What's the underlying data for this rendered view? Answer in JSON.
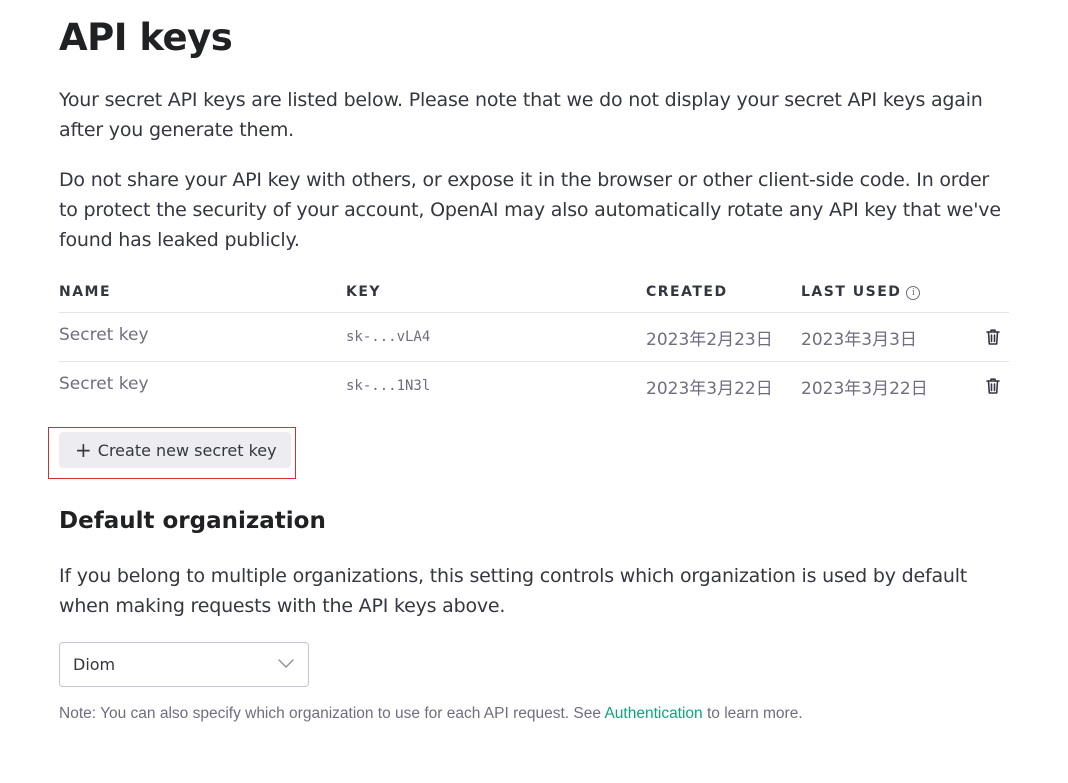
{
  "page": {
    "title": "API keys",
    "intro_1": "Your secret API keys are listed below. Please note that we do not display your secret API keys again after you generate them.",
    "intro_2": "Do not share your API key with others, or expose it in the browser or other client-side code. In order to protect the security of your account, OpenAI may also automatically rotate any API key that we've found has leaked publicly."
  },
  "keys_table": {
    "headers": {
      "name": "NAME",
      "key": "KEY",
      "created": "CREATED",
      "last_used": "LAST USED",
      "last_used_info_icon": "i"
    },
    "rows": [
      {
        "name": "Secret key",
        "key": "sk-...vLA4",
        "created": "2023年2月23日",
        "last_used": "2023年3月3日",
        "action_icon": "trash-icon"
      },
      {
        "name": "Secret key",
        "key": "sk-...1N3l",
        "created": "2023年3月22日",
        "last_used": "2023年3月22日",
        "action_icon": "trash-icon"
      }
    ]
  },
  "create_button": {
    "icon": "+",
    "label": "Create new secret key"
  },
  "default_org": {
    "heading": "Default organization",
    "description": "If you belong to multiple organizations, this setting controls which organization is used by default when making requests with the API keys above.",
    "select_value": "Diom",
    "select_icon": "chevron-down-icon"
  },
  "note": {
    "prefix": "Note: You can also specify which organization to use for each API request. See ",
    "link": "Authentication",
    "suffix": " to learn more."
  },
  "colors": {
    "link": "#10a37f",
    "highlight": "#d32f2f",
    "button_bg": "#ececf1"
  }
}
